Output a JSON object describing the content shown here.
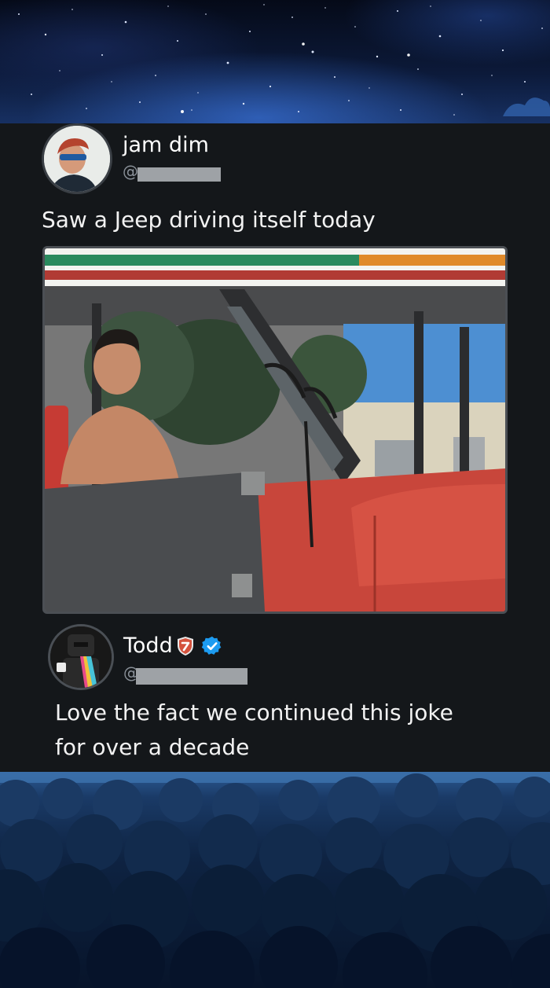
{
  "post": {
    "author_name": "jam dim",
    "handle_prefix": "@",
    "text": "Saw a Jeep driving itself today",
    "media_description": "photo-of-red-jeep-with-driver"
  },
  "reply": {
    "author_name": "Todd",
    "handle_prefix": "@",
    "text_line1": "Love the fact we continued this joke",
    "text_line2": "for over a decade",
    "badges": [
      "shield-badge-icon",
      "verified-icon"
    ]
  },
  "colors": {
    "card_background": "#14171a",
    "verified_blue": "#1d9bf0",
    "text_primary": "#f2f2f2",
    "handle_gray": "#8a9199",
    "redaction_gray": "#9ea2a6"
  }
}
